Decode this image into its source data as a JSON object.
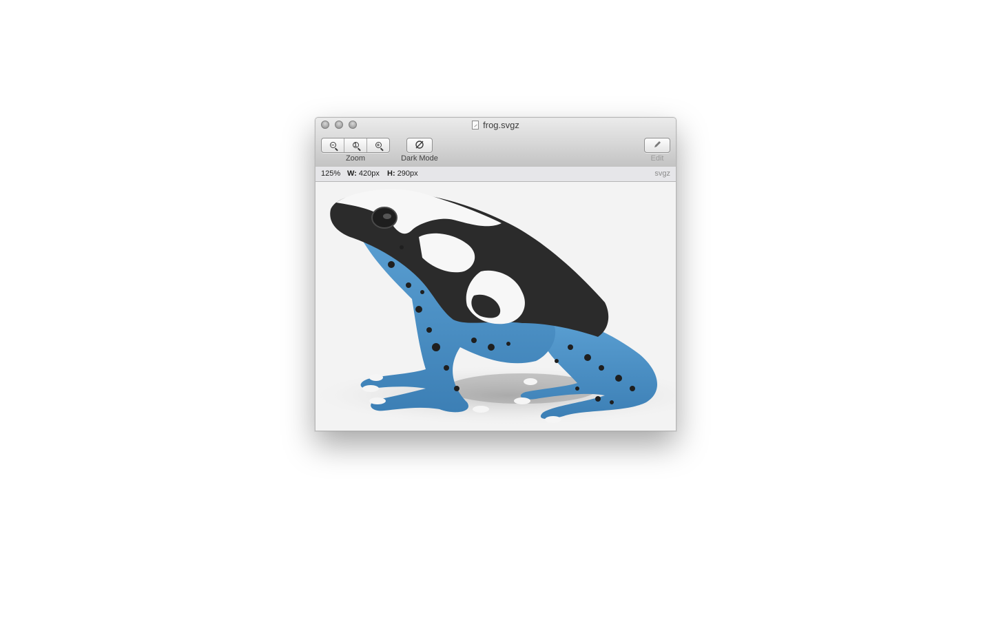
{
  "window": {
    "title": "frog.svgz"
  },
  "toolbar": {
    "zoom_label": "Zoom",
    "dark_mode_label": "Dark Mode",
    "edit_label": "Edit",
    "zoom_out_icon": "zoom-out-icon",
    "zoom_actual_icon": "zoom-actual-size-icon",
    "zoom_in_icon": "zoom-in-icon"
  },
  "info": {
    "zoom_percent": "125%",
    "width_label": "W:",
    "width_value": "420px",
    "height_label": "H:",
    "height_value": "290px",
    "format": "svgz"
  },
  "colors": {
    "frog_blue": "#4a8ec4",
    "frog_black": "#2b2b2b",
    "canvas_bg": "#f3f3f3"
  }
}
